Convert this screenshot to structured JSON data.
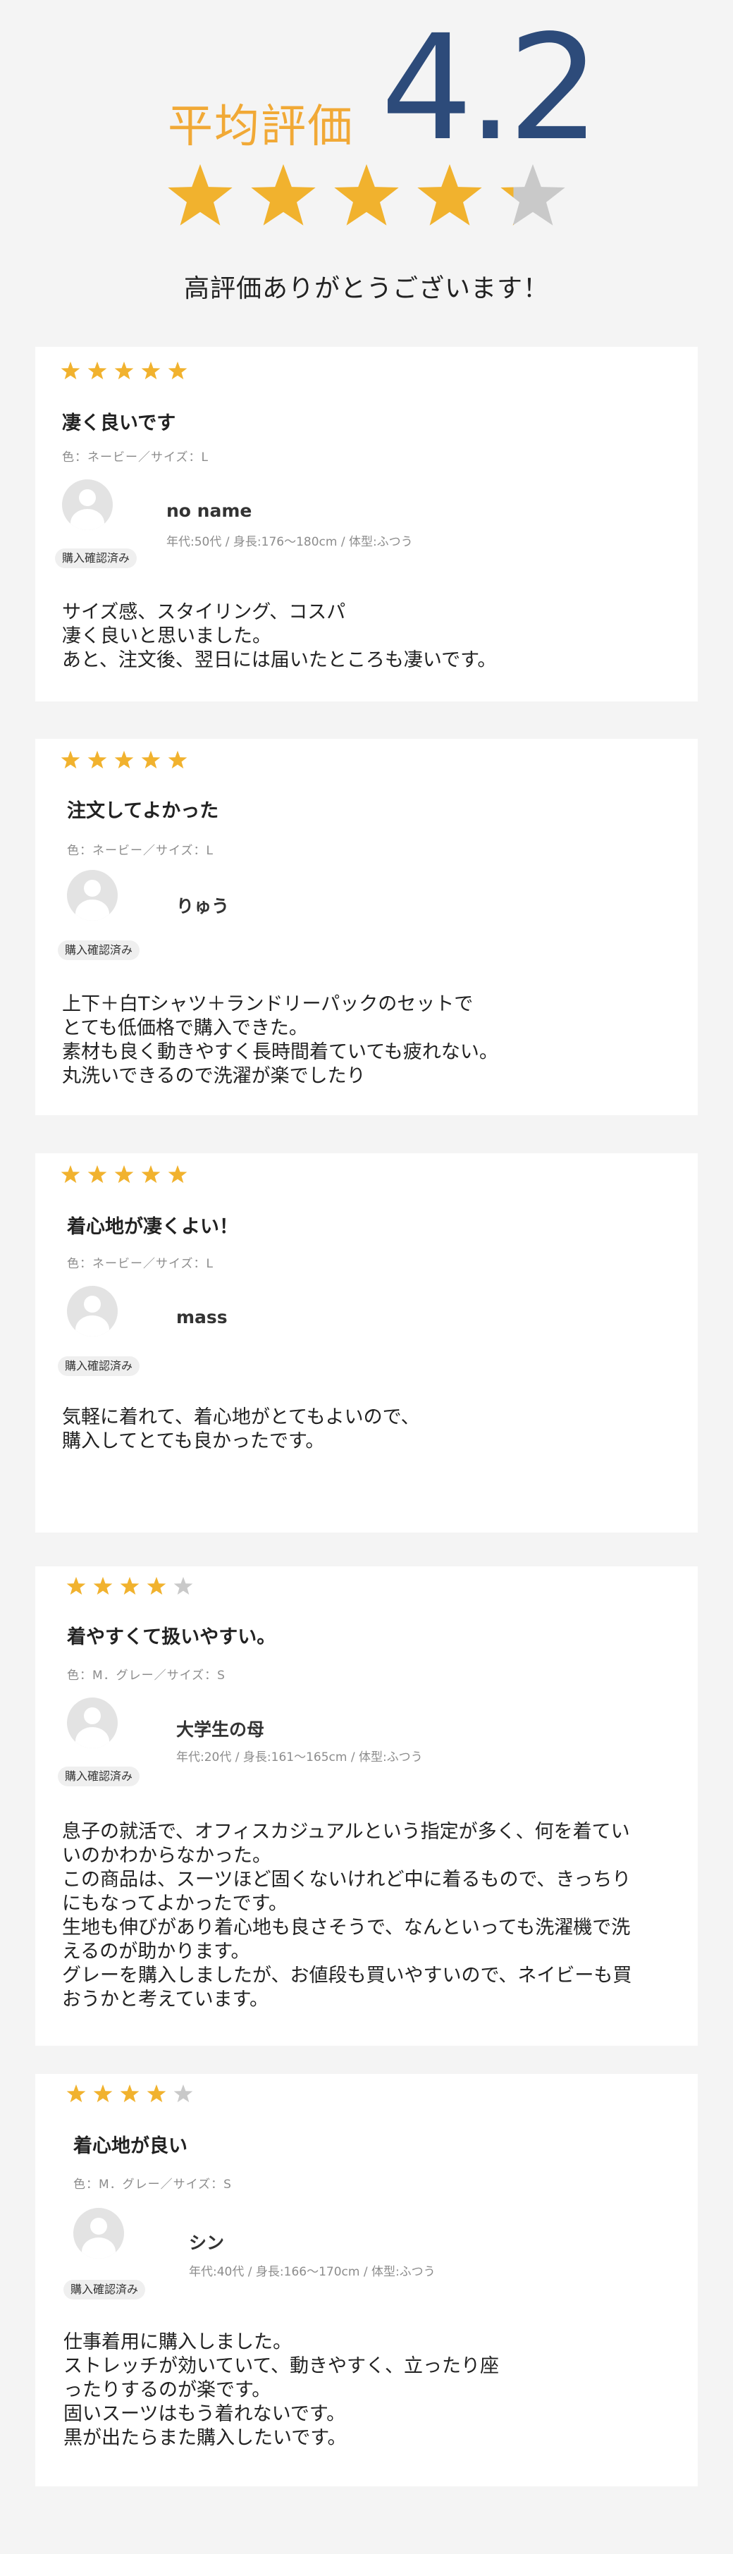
{
  "summary": {
    "label": "平均評価",
    "average": "4.2",
    "rating": 4.2,
    "thanks": "高評価ありがとうございます！"
  },
  "colors": {
    "star_on": "#f1b22e",
    "star_off": "#c9c9c9",
    "accent": "#f1a936",
    "number": "#2d4b7a"
  },
  "reviews": [
    {
      "stars": 5,
      "title": "凄く良いです",
      "spec": "色：ネービー／サイズ：L",
      "name": "no name",
      "user_meta": "年代:50代  /  身長:176〜180cm  /  体型:ふつう",
      "badge": "購入確認済み",
      "body": "サイズ感、スタイリング、コスパ\n凄く良いと思いました。\nあと、注文後、翌日には届いたところも凄いです。"
    },
    {
      "stars": 5,
      "title": "注文してよかった",
      "spec": "色：ネービー／サイズ：L",
      "name": "りゅう",
      "user_meta": "",
      "badge": "購入確認済み",
      "body": "上下＋白Tシャツ＋ランドリーパックのセットで\nとても低価格で購入できた。\n素材も良く動きやすく長時間着ていても疲れない。\n丸洗いできるので洗濯が楽でしたり"
    },
    {
      "stars": 5,
      "title": "着心地が凄くよい！",
      "spec": "色：ネービー／サイズ：L",
      "name": "mass",
      "user_meta": "",
      "badge": "購入確認済み",
      "body": "気軽に着れて、着心地がとてもよいので、\n購入してとても良かったです。"
    },
    {
      "stars": 4,
      "title": "着やすくて扱いやすい。",
      "spec": "色：M．グレー／サイズ：S",
      "name": "大学生の母",
      "user_meta": "年代:20代  /  身長:161〜165cm  /  体型:ふつう",
      "badge": "購入確認済み",
      "body": "息子の就活で、オフィスカジュアルという指定が多く、何を着てい\nいのかわからなかった。\nこの商品は、スーツほど固くないけれど中に着るもので、きっちり\nにもなってよかったです。\n生地も伸びがあり着心地も良さそうで、なんといっても洗濯機で洗\nえるのが助かります。\nグレーを購入しましたが、お値段も買いやすいので、ネイビーも買\nおうかと考えています。"
    },
    {
      "stars": 4,
      "title": "着心地が良い",
      "spec": "色：M．グレー／サイズ：S",
      "name": "シン",
      "user_meta": "年代:40代  /  身長:166〜170cm  /  体型:ふつう",
      "badge": "購入確認済み",
      "body": "仕事着用に購入しました。\nストレッチが効いていて、動きやすく、立ったり座\nったりするのが楽です。\n固いスーツはもう着れないです。\n黒が出たらまた購入したいです。"
    }
  ]
}
